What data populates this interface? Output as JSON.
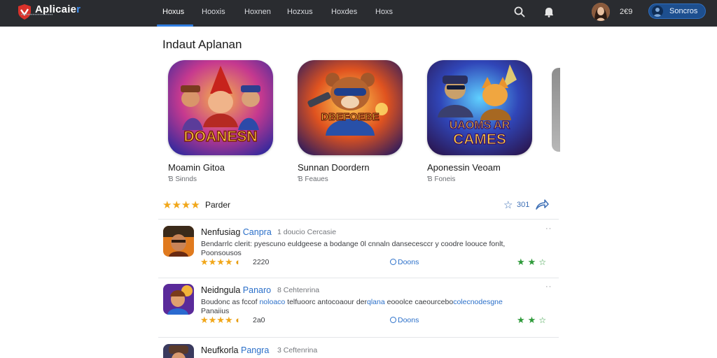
{
  "app": {
    "logo_text": "Aplicaie",
    "logo_accent": "r",
    "logo_subtitle": "•••••••••••••••••••"
  },
  "nav": {
    "items": [
      {
        "label": "Hoxus"
      },
      {
        "label": "Hooxis"
      },
      {
        "label": "Hoxnen"
      },
      {
        "label": "Hozxus"
      },
      {
        "label": "Hoxdes"
      },
      {
        "label": "Hoxs"
      }
    ],
    "active_index": 0
  },
  "user": {
    "count": "2€9",
    "signin_label": "Soncros"
  },
  "featured": {
    "title": "Indaut Aplanan",
    "items": [
      {
        "name": "Moamin Gitoa",
        "meta": "Ɓ Sɨnnds",
        "icon_text": "DOANESN",
        "icon": "heroes-game-icon"
      },
      {
        "name": "Sunnan Doordern",
        "meta": "Ɓ Feaues",
        "icon_text": "DBEFOEBE",
        "icon": "bear-fighter-game-icon"
      },
      {
        "name": "Aponessin Veoam",
        "meta": "Ɓ Foneis",
        "icon_text": [
          "UAOMS AR",
          "CAMES"
        ],
        "icon": "space-cats-game-icon"
      }
    ]
  },
  "rating": {
    "stars": "★★★★",
    "label": "Parder",
    "fav_count": "301"
  },
  "list": [
    {
      "title": "Nenfusiag",
      "title_highlight": "Canpra",
      "subtitle": "1  doucio  Cercasie",
      "desc_line1": "Bendarrlc clerit: pyescuno euldgeese a bodange  0l  cnnaln dansecesccr y coodre loouce fonlt,",
      "desc_line2": "Poonsousos",
      "desc_highlight": "",
      "stars": "★★★★",
      "half": "◐",
      "score": "2220",
      "action": "Doons",
      "green": "★★",
      "green_outline": "☆",
      "icon": "warrior-game-icon"
    },
    {
      "title": "Neidngula",
      "title_highlight": "Panaro",
      "subtitle": "8  Cehtenrina",
      "desc_line1": "Boudonc as fccof ",
      "desc_highlight_a": "noloaco",
      "desc_mid": " telfuoorc antocoaour  der",
      "desc_highlight_b": "qlana",
      "desc_tail": "  eooolce  caeourcebo",
      "desc_highlight_c": "colecnodesgne",
      "desc_line2": "Panaiius",
      "stars": "★★★★",
      "half": "◐",
      "score": "2a0",
      "action": "Doons",
      "green": "★★",
      "green_outline": "☆",
      "icon": "mage-game-icon"
    },
    {
      "title": "Neufkorla",
      "title_highlight": "Pangra",
      "subtitle": "3  Ceftenrina",
      "icon": "pilot-game-icon"
    }
  ]
}
